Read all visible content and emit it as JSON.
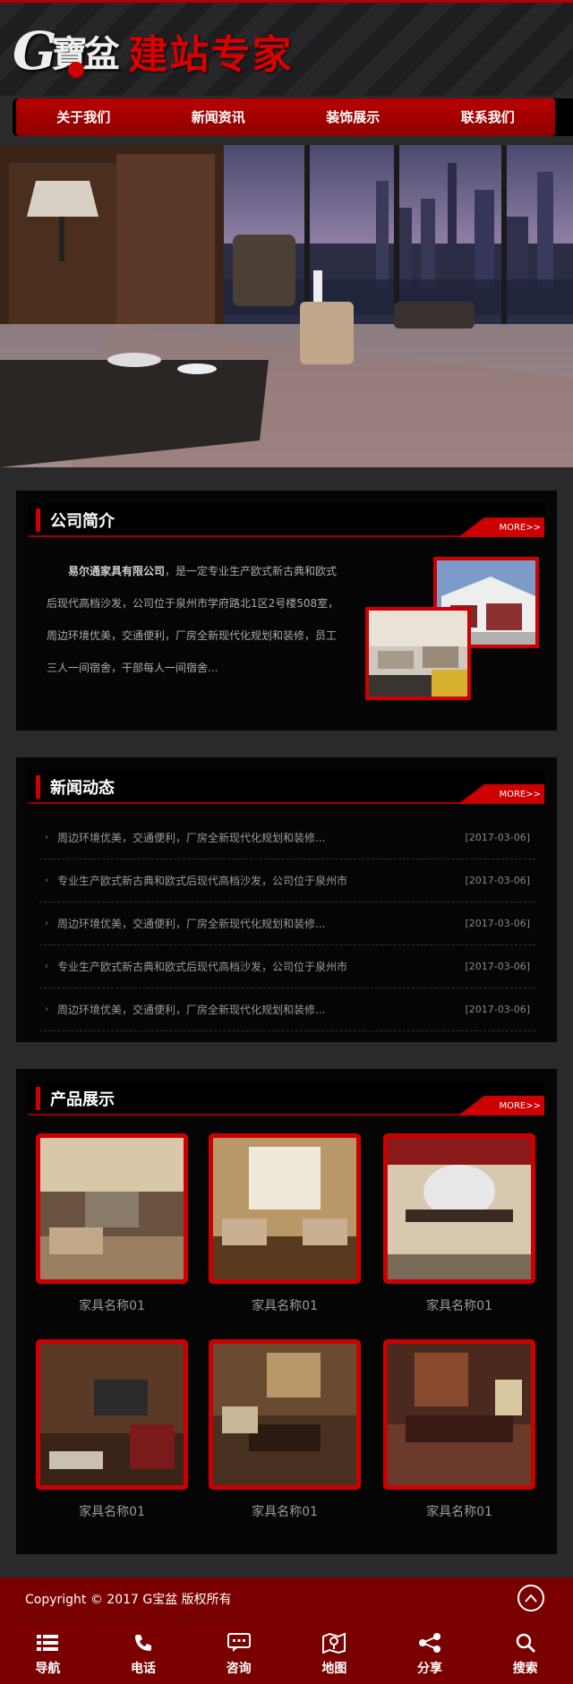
{
  "header": {
    "logo_letter": "G",
    "logo_text": "寶盆",
    "slogan": "建站专家"
  },
  "nav": {
    "items": [
      "关于我们",
      "新闻资讯",
      "装饰展示",
      "联系我们"
    ]
  },
  "about": {
    "title": "公司简介",
    "more": "MORE>>",
    "company": "易尔通家具有限公司",
    "text": "，是一定专业生产欧式新古典和欧式后现代高档沙发，公司位于泉州市学府路北1区2号楼508室，周边环境优美，交通便利，厂房全新现代化规划和装修，员工三人一间宿舍，干部每人一间宿舍..."
  },
  "news": {
    "title": "新闻动态",
    "more": "MORE>>",
    "items": [
      {
        "title": "周边环境优美，交通便利，厂房全新现代化规划和装修...",
        "date": "[2017-03-06]"
      },
      {
        "title": "专业生产欧式新古典和欧式后现代高档沙发，公司位于泉州市",
        "date": "[2017-03-06]"
      },
      {
        "title": "周边环境优美，交通便利，厂房全新现代化规划和装修...",
        "date": "[2017-03-06]"
      },
      {
        "title": "专业生产欧式新古典和欧式后现代高档沙发，公司位于泉州市",
        "date": "[2017-03-06]"
      },
      {
        "title": "周边环境优美，交通便利，厂房全新现代化规划和装修...",
        "date": "[2017-03-06]"
      }
    ]
  },
  "products": {
    "title": "产品展示",
    "more": "MORE>>",
    "items": [
      "家具名称01",
      "家具名称01",
      "家具名称01",
      "家具名称01",
      "家具名称01",
      "家具名称01"
    ]
  },
  "footer": {
    "copyright": "Copyright © 2017 G宝盆 版权所有",
    "totop": "^"
  },
  "bottombar": {
    "items": [
      {
        "label": "导航",
        "icon": "menu-icon"
      },
      {
        "label": "电话",
        "icon": "phone-icon"
      },
      {
        "label": "咨询",
        "icon": "chat-icon"
      },
      {
        "label": "地图",
        "icon": "map-icon"
      },
      {
        "label": "分享",
        "icon": "share-icon"
      },
      {
        "label": "搜索",
        "icon": "search-icon"
      }
    ]
  },
  "colors": {
    "accent": "#cc0000",
    "footer": "#7a0000",
    "background": "#2a2a2c"
  }
}
